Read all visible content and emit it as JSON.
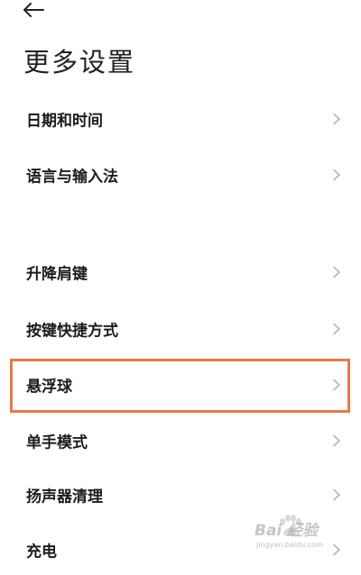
{
  "header": {
    "back_icon": "arrow-left-icon",
    "title": "更多设置"
  },
  "settings": {
    "group1": [
      {
        "label": "日期和时间",
        "icon": "chevron-right-icon"
      },
      {
        "label": "语言与输入法",
        "icon": "chevron-right-icon"
      }
    ],
    "group2": [
      {
        "label": "升降肩键",
        "icon": "chevron-right-icon"
      },
      {
        "label": "按键快捷方式",
        "icon": "chevron-right-icon"
      },
      {
        "label": "悬浮球",
        "icon": "chevron-right-icon",
        "highlighted": true
      },
      {
        "label": "单手模式",
        "icon": "chevron-right-icon"
      },
      {
        "label": "扬声器清理",
        "icon": "chevron-right-icon"
      },
      {
        "label": "充电",
        "icon": "chevron-right-icon"
      }
    ]
  },
  "highlight": {
    "color": "#e87a45",
    "target": "悬浮球"
  },
  "watermark": {
    "brand": "Bai 经验",
    "url": "jingyan.baidu.com"
  }
}
